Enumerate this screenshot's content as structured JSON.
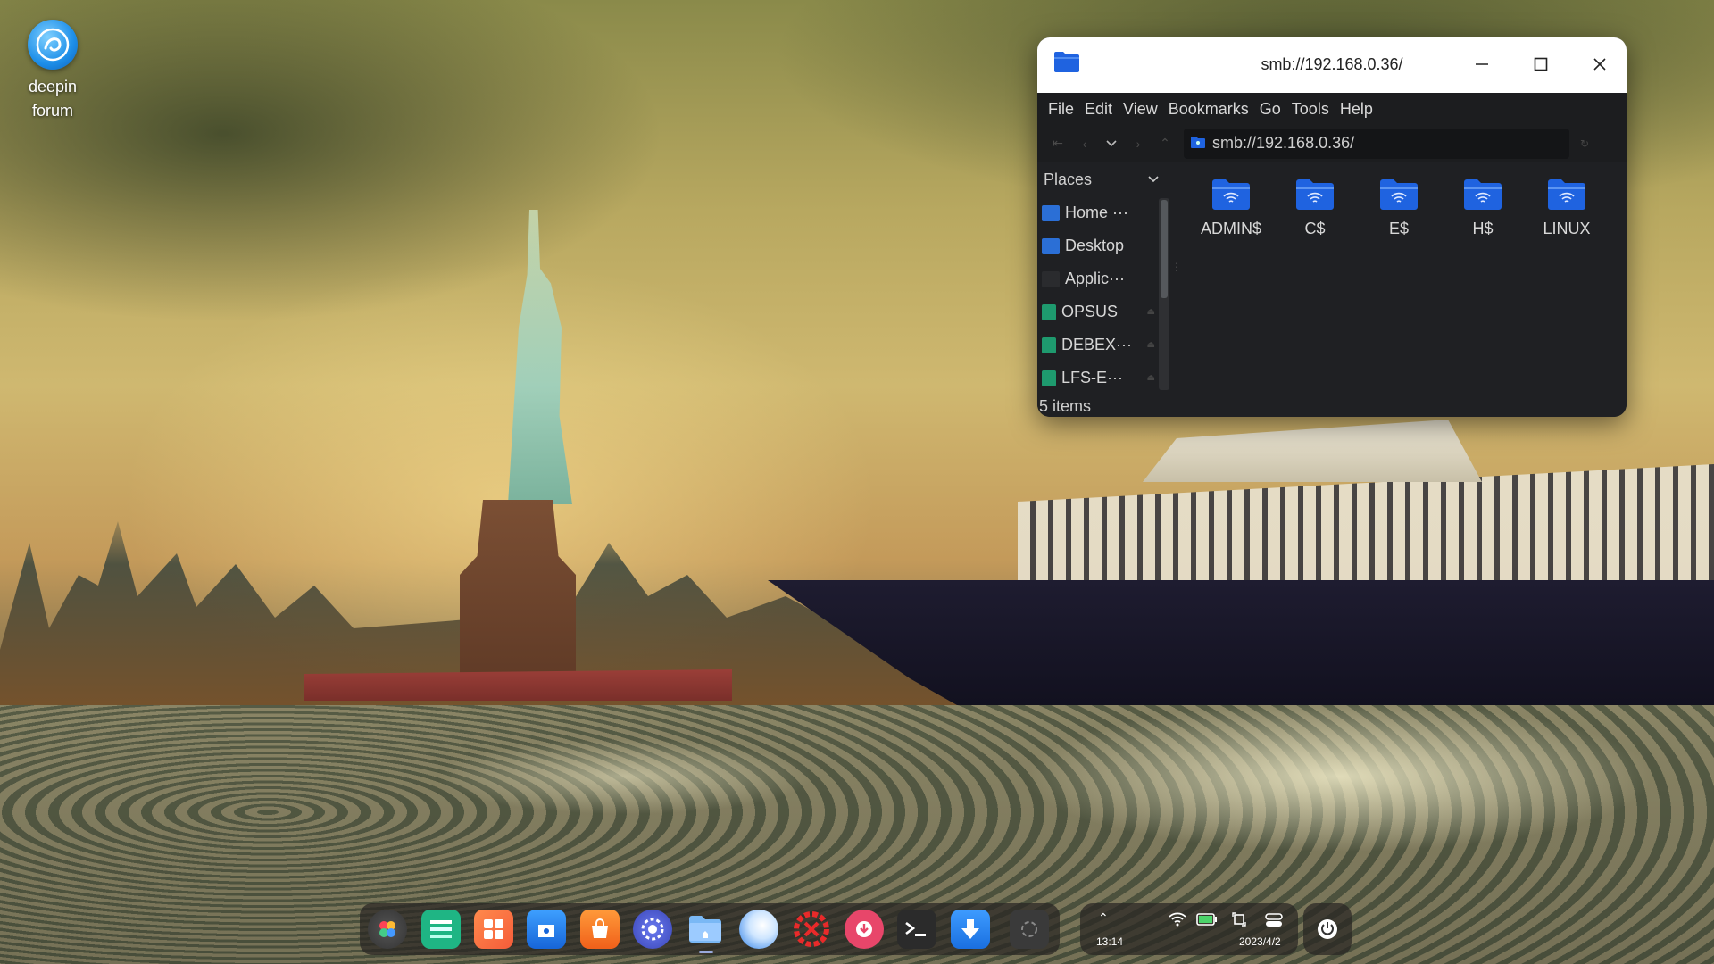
{
  "desktop": {
    "icons": [
      {
        "label_line1": "deepin",
        "label_line2": "forum",
        "icon": "deepin-forum-icon"
      }
    ]
  },
  "window": {
    "title": "smb://192.168.0.36/",
    "menu": [
      "File",
      "Edit",
      "View",
      "Bookmarks",
      "Go",
      "Tools",
      "Help"
    ],
    "address": "smb://192.168.0.36/",
    "places_header": "Places",
    "places": [
      {
        "label": "Home ···",
        "icon": "home-folder-icon",
        "color": "#2b6fd6"
      },
      {
        "label": "Desktop",
        "icon": "desktop-folder-icon",
        "color": "#2b6fd6"
      },
      {
        "label": "Applic···",
        "icon": "applications-icon",
        "color": "#2a2b2e"
      },
      {
        "label": "OPSUS",
        "icon": "drive-icon",
        "color": "#1e9a6e"
      },
      {
        "label": "DEBEX···",
        "icon": "drive-icon",
        "color": "#1e9a6e"
      },
      {
        "label": "LFS-E···",
        "icon": "drive-icon",
        "color": "#1e9a6e"
      }
    ],
    "status": "5 items",
    "shares": [
      "ADMIN$",
      "C$",
      "E$",
      "H$",
      "LINUX"
    ]
  },
  "dock": {
    "apps": [
      "launcher-icon",
      "deepin-terminal-like-icon",
      "multitask-view-icon",
      "app-store-icon",
      "shop-icon",
      "settings-icon",
      "file-manager-icon",
      "browser-icon",
      "system-repair-icon",
      "downloader-icon",
      "terminal-icon",
      "update-download-icon",
      "trash-icon"
    ]
  },
  "tray": {
    "time": "13:14",
    "date": "2023/4/2"
  },
  "colors": {
    "accent": "#2b6fd6",
    "folder_blue": "#1f63e0"
  }
}
